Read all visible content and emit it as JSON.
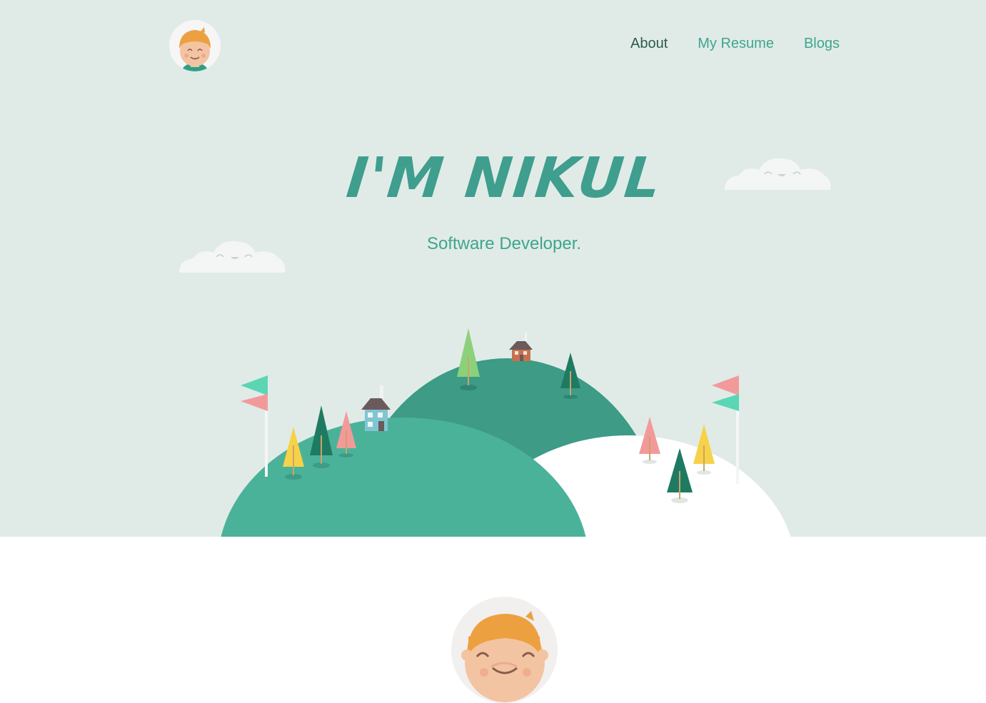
{
  "nav": {
    "items": [
      {
        "label": "About",
        "active": true
      },
      {
        "label": "My Resume",
        "active": false
      },
      {
        "label": "Blogs",
        "active": false
      }
    ]
  },
  "hero": {
    "title": "I'M NIKUL",
    "subtitle": "Software Developer."
  },
  "colors": {
    "hero_bg": "#e0ebe7",
    "accent": "#3fa58d",
    "nav_active": "#2d5a50",
    "hill_dark": "#3d9b86",
    "hill_light": "#4bb29a",
    "hair": "#eda03f",
    "skin": "#f3c4a1"
  },
  "icons": [
    "logo-avatar",
    "cloud-icon",
    "flag-icon",
    "tree-icon",
    "house-icon",
    "avatar-large"
  ]
}
